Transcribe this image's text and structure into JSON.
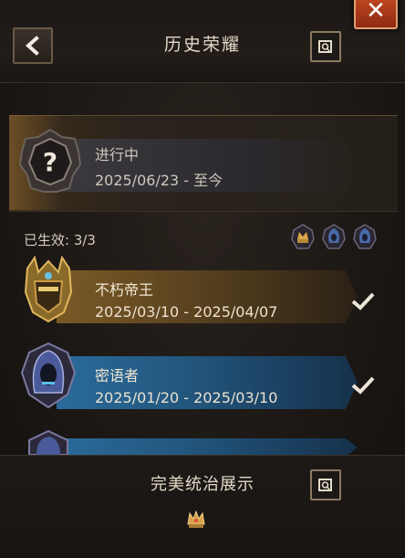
{
  "header": {
    "close_glyph": "✕",
    "back_icon": "chevron-left-icon",
    "title": "历史荣耀",
    "scroll_icon": "scroll-icon"
  },
  "in_progress": {
    "status": "进行中",
    "dates": "2025/06/23 - 至今",
    "badge_icon": "question-mark-badge-icon"
  },
  "effective": {
    "label": "已生效: 3/3",
    "icons": [
      "gold-crown-icon",
      "blue-hood-icon",
      "blue-hood-icon"
    ]
  },
  "titles": [
    {
      "name": "不朽帝王",
      "dates": "2025/03/10 - 2025/04/07",
      "tier": "gold",
      "badge_icon": "gold-king-helmet-icon",
      "checked": true
    },
    {
      "name": "密语者",
      "dates": "2025/01/20 - 2025/03/10",
      "tier": "blue",
      "badge_icon": "hooded-whisperer-icon",
      "checked": true
    },
    {
      "name": "",
      "dates": "",
      "tier": "blue",
      "badge_icon": "hooded-whisperer-icon",
      "checked": false
    }
  ],
  "footer": {
    "title": "完美统治展示",
    "scroll_icon": "scroll-icon",
    "emblem_icon": "gold-crown-emblem-icon"
  },
  "colors": {
    "gold_banner": "#7a5a26",
    "blue_banner": "#2a6a9a",
    "close_button": "#c64a22"
  }
}
